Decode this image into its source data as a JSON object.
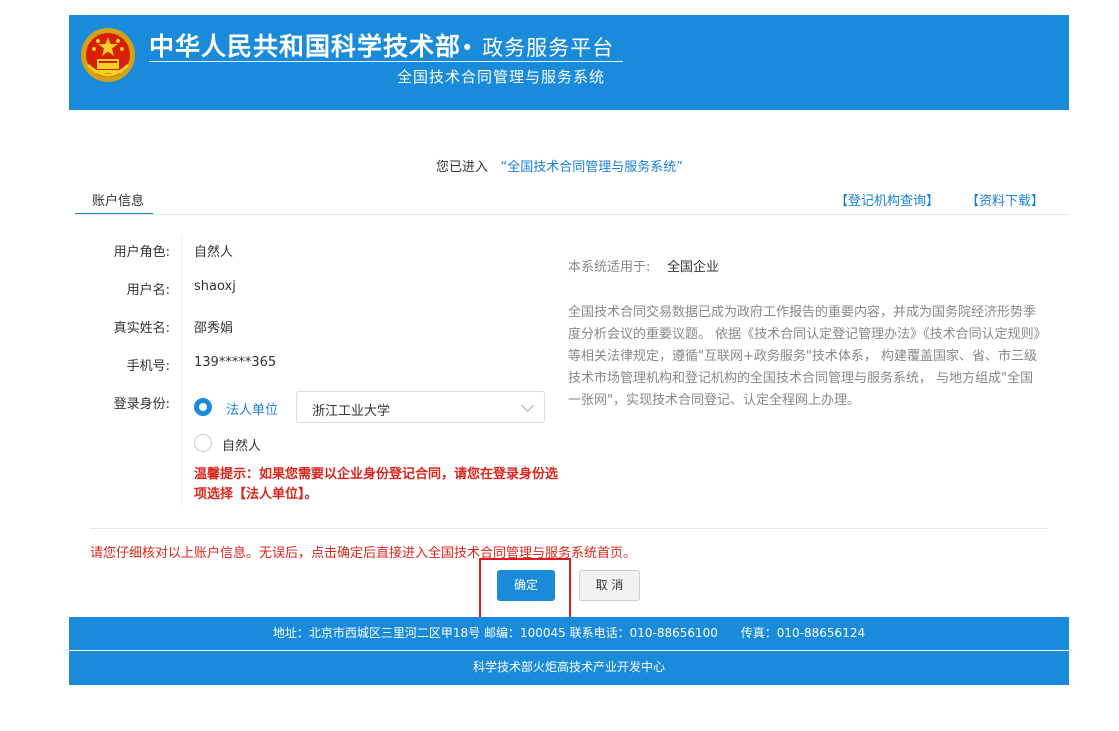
{
  "header": {
    "title": "中华人民共和国科学技术部",
    "title_sub": "• 政务服务平台",
    "subtitle": "全国技术合同管理与服务系统"
  },
  "entered": {
    "prefix": "您已进入",
    "system": "“全国技术合同管理与服务系统”"
  },
  "tabs": {
    "account": "账户信息",
    "registry_query": "【登记机构查询】",
    "download": "【资料下载】"
  },
  "form": {
    "role_label": "用户角色:",
    "role_value": "自然人",
    "username_label": "用户名:",
    "username_value": "shaoxj",
    "realname_label": "真实姓名:",
    "realname_value": "邵秀娟",
    "phone_label": "手机号:",
    "phone_value": "139*****365",
    "identity_label": "登录身份:",
    "option_legal": "法人单位",
    "option_natural": "自然人",
    "legal_selected": true,
    "org_select_value": "浙江工业大学",
    "warning": "温馨提示：如果您需要以企业身份登记合同，请您在登录身份选项选择【法人单位】。"
  },
  "info": {
    "applies_label": "本系统适用于:",
    "applies_value": "全国企业",
    "description": "全国技术合同交易数据已成为政府工作报告的重要内容，并成为国务院经济形势季度分析会议的重要议题。 依据《技术合同认定登记管理办法》《技术合同认定规则》等相关法律规定，遵循\"互联网+政务服务\"技术体系， 构建覆盖国家、省、市三级技术市场管理机构和登记机构的全国技术合同管理与服务系统， 与地方组成\"全国一张网\"，实现技术合同登记、认定全程网上办理。"
  },
  "notice": "请您仔细核对以上账户信息。无误后，点击确定后直接进入全国技术合同管理与服务系统首页。",
  "buttons": {
    "ok": "确定",
    "cancel": "取 消"
  },
  "footer": {
    "line1": "地址：北京市西城区三里河二区甲18号 邮编：100045 联系电话：010-88656100      传真：010-88656124",
    "line2": "科学技术部火炬高技术产业开发中心"
  },
  "colors": {
    "brand_blue": "#1a8bdb",
    "link_blue": "#1a7fd4",
    "warning_red": "#d9261c",
    "highlight_red": "#e8171f"
  }
}
